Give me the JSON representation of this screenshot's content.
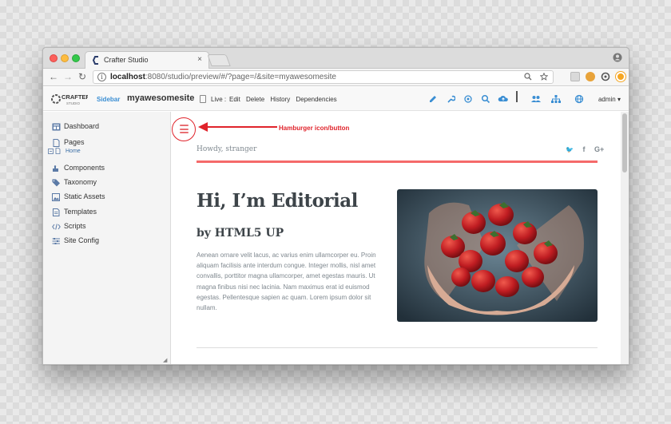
{
  "browser": {
    "tab_title": "Crafter Studio",
    "tab_close": "×",
    "url_host": "localhost",
    "url_rest": ":8080/studio/preview/#/?page=/&site=myawesomesite",
    "back": "←",
    "forward": "→",
    "reload": "↻",
    "url_zoom_icon": "search-icon",
    "url_star_icon": "star-icon",
    "extension_colors": [
      "#d9d9d9",
      "#e8a33a",
      "#555555",
      "#f5a623"
    ]
  },
  "studio_toolbar": {
    "sidebar_label": "Sidebar",
    "site_name": "myawesomesite",
    "live_label": "Live :",
    "actions": [
      "Edit",
      "Delete",
      "History",
      "Dependencies"
    ],
    "tool_icons": [
      "pencil-icon",
      "wrench-icon",
      "target-icon",
      "search-icon",
      "cloud-upload-icon",
      "users-icon",
      "sitemap-icon",
      "globe-icon"
    ],
    "admin_label": "admin ▾",
    "accent": "#3a8ed3"
  },
  "sidebar": {
    "items": [
      {
        "label": "Dashboard",
        "icon": "dashboard-icon"
      },
      {
        "label": "Pages",
        "icon": "pages-icon"
      },
      {
        "label": "Components",
        "icon": "components-icon"
      },
      {
        "label": "Taxonomy",
        "icon": "tag-icon"
      },
      {
        "label": "Static Assets",
        "icon": "image-icon"
      },
      {
        "label": "Templates",
        "icon": "template-icon"
      },
      {
        "label": "Scripts",
        "icon": "code-icon"
      },
      {
        "label": "Site Config",
        "icon": "sliders-icon"
      }
    ],
    "pages_child": "Home"
  },
  "preview": {
    "annotation_label": "Hamburger icon/button",
    "annotation_color": "#e0232b",
    "howdy": "Howdy, stranger",
    "social": [
      "twitter-icon",
      "facebook-icon",
      "google-plus-icon"
    ],
    "social_glyphs": [
      "🐦",
      "f",
      "G+"
    ],
    "hero_title": "Hi, I’m Editorial",
    "hero_subtitle": "by HTML5 UP",
    "hero_body": "Aenean ornare velit lacus, ac varius enim ullamcorper eu. Proin aliquam facilisis ante interdum congue. Integer mollis, nisl amet convallis, porttitor magna ullamcorper, amet egestas mauris. Ut magna finibus nisi nec lacinia. Nam maximus erat id euismod egestas. Pellentesque sapien ac quam. Lorem ipsum dolor sit nullam.",
    "accent": "#f56a6a",
    "hero_image": "hands-holding-strawberries"
  }
}
